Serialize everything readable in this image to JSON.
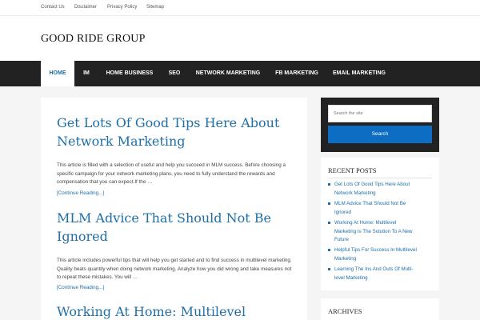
{
  "topbar": {
    "links": [
      "Contact Us",
      "Disclaimer",
      "Privacy Policy",
      "Sitemap"
    ]
  },
  "header": {
    "title": "GOOD RIDE GROUP"
  },
  "nav": {
    "items": [
      "HOME",
      "IM",
      "HOME BUSINESS",
      "SEO",
      "NETWORK MARKETING",
      "FB MARKETING",
      "EMAIL MARKETING"
    ],
    "active": "HOME"
  },
  "posts": [
    {
      "title_line1": "Get Lots Of Good Tips Here About",
      "title_line2": "Network Marketing",
      "excerpt": "This article is filled with a selection of useful and help you succeed in MLM success. Before choosing a specific campaign for your network marketing plans, you need to fully understand the rewards and compensation that you can expect.If the …",
      "more": "[Continue Reading...]"
    },
    {
      "title_line1": "MLM Advice That Should Not Be",
      "title_line2": "Ignored",
      "excerpt": "This article includes powerful tips that will help you get started and to find success in multilevel marketing. Quality beats quantity when doing network marketing. Analyze how you did wrong and take measures not to repeat these mistakes. You will …",
      "more": "[Continue Reading...]"
    },
    {
      "title_line1": "Working At Home: Multilevel"
    }
  ],
  "search": {
    "placeholder": "Search the site",
    "button": "Search"
  },
  "recent_posts": {
    "title": "RECENT POSTS",
    "items": [
      [
        "Get Lots Of Good Tips Here About",
        "Network Marketing"
      ],
      [
        "MLM Advice That Should Not Be",
        "Ignored"
      ],
      [
        "Working At Home: Multilevel",
        "Marketing Is The Solution To A New",
        "Future"
      ],
      [
        "Helpful Tips For Success In Multilevel",
        "Marketing"
      ],
      [
        "Learning The Ins And Outs Of Multi-",
        "level Marketing"
      ]
    ]
  },
  "archives": {
    "title": "ARCHIVES"
  },
  "colors": {
    "link": "#1e6fa8",
    "nav_bg": "#222222",
    "search_button": "#0d6dc3"
  }
}
